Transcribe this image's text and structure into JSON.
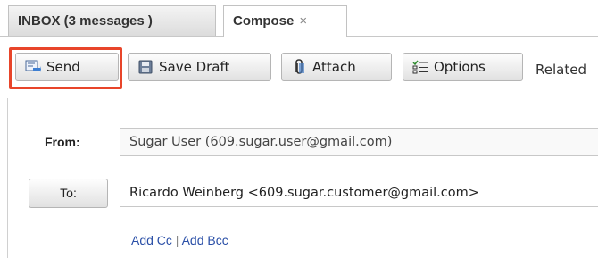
{
  "tabs": {
    "inbox_label": "INBOX (3 messages )",
    "compose_label": "Compose",
    "close_glyph": "×"
  },
  "toolbar": {
    "send_label": "Send",
    "save_draft_label": "Save Draft",
    "attach_label": "Attach",
    "options_label": "Options",
    "related_label": "Related"
  },
  "form": {
    "from_label": "From:",
    "from_value": "Sugar User (609.sugar.user@gmail.com)",
    "to_button_label": "To:",
    "to_value": "Ricardo Weinberg <609.sugar.customer@gmail.com>",
    "add_cc_label": "Add Cc",
    "separator": " | ",
    "add_bcc_label": "Add Bcc"
  },
  "colors": {
    "highlight": "#e8452a",
    "link": "#2a4fa7"
  },
  "icons": {
    "send": "send-icon",
    "save": "floppy-disk-icon",
    "attach": "paperclip-icon",
    "options": "checklist-icon"
  }
}
